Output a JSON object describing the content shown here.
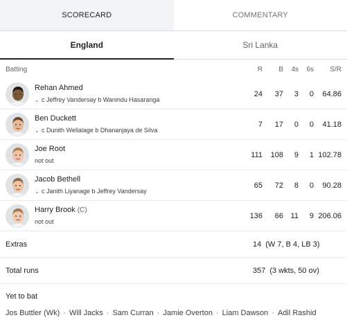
{
  "tabs": {
    "scorecard": "SCORECARD",
    "commentary": "COMMENTARY"
  },
  "teams": {
    "england": "England",
    "srilanka": "Sri Lanka"
  },
  "header": {
    "batting": "Batting",
    "r": "R",
    "b": "B",
    "fours": "4s",
    "sixes": "6s",
    "sr": "S/R"
  },
  "batters": [
    {
      "name": "Rehan Ahmed",
      "captain": "",
      "dismissal": "c Jeffrey Vandersay b Wanindu Hasaranga",
      "r": "24",
      "b": "37",
      "fours": "3",
      "sixes": "0",
      "sr": "64.86",
      "skin": "#7a5a3a",
      "hair": "#1c1410"
    },
    {
      "name": "Ben Duckett",
      "captain": "",
      "dismissal": "c Dunith Wellalage b Dhananjaya de Silva",
      "r": "7",
      "b": "17",
      "fours": "0",
      "sixes": "0",
      "sr": "41.18",
      "skin": "#e8b89a",
      "hair": "#6b4a2e"
    },
    {
      "name": "Joe Root",
      "captain": "",
      "dismissal": "not out",
      "r": "111",
      "b": "108",
      "fours": "9",
      "sixes": "1",
      "sr": "102.78",
      "skin": "#f0c4a8",
      "hair": "#b08050"
    },
    {
      "name": "Jacob Bethell",
      "captain": "",
      "dismissal": "c Janith Liyanage b Jeffrey Vandersay",
      "r": "65",
      "b": "72",
      "fours": "8",
      "sixes": "0",
      "sr": "90.28",
      "skin": "#eec3a5",
      "hair": "#8a6a4a"
    },
    {
      "name": "Harry Brook",
      "captain": "(C)",
      "dismissal": "not out",
      "r": "136",
      "b": "66",
      "fours": "11",
      "sixes": "9",
      "sr": "206.06",
      "skin": "#f2c8ac",
      "hair": "#a07850"
    }
  ],
  "extras": {
    "label": "Extras",
    "value": "14",
    "detail": "(W 7, B 4, LB 3)"
  },
  "total": {
    "label": "Total runs",
    "value": "357",
    "detail": "(3 wkts, 50 ov)"
  },
  "yet_to_bat": {
    "title": "Yet to bat",
    "players": [
      "Jos Buttler (Wk)",
      "Will Jacks",
      "Sam Curran",
      "Jamie Overton",
      "Liam Dawson",
      "Adil Rashid"
    ],
    "separator": "·"
  }
}
